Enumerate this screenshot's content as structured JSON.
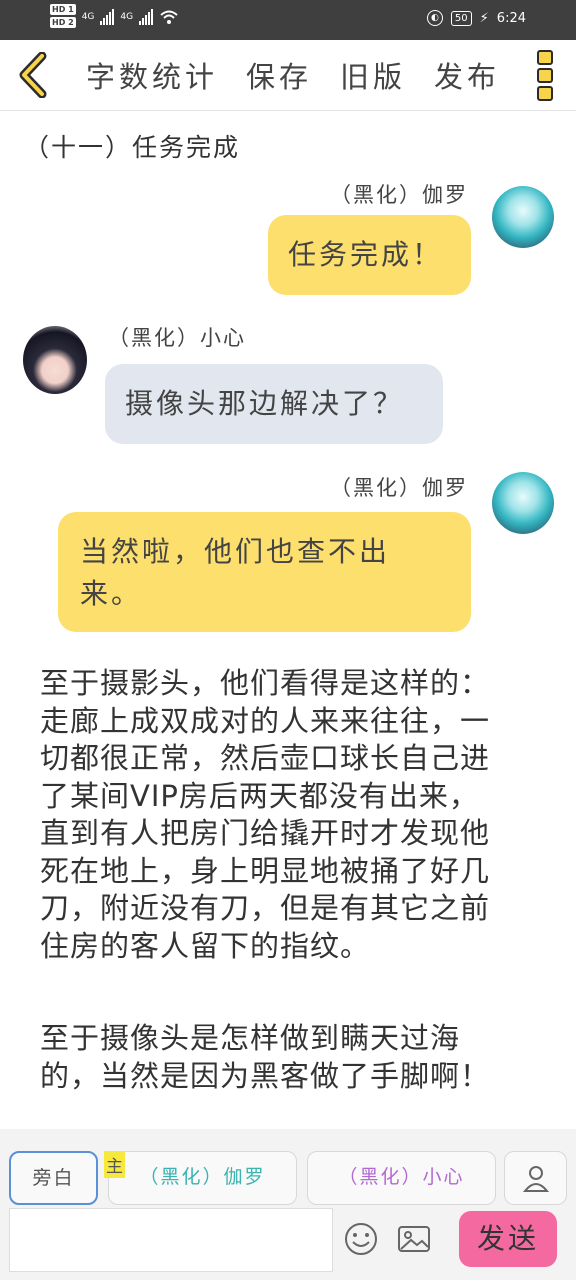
{
  "status_bar": {
    "hd_top": "HD 1",
    "hd_bottom": "HD 2",
    "net1": "4G",
    "net2": "4G",
    "battery": "50",
    "time": "6:24"
  },
  "toolbar": {
    "word_count": "字数统计",
    "save": "保存",
    "old_version": "旧版",
    "publish": "发布"
  },
  "chapter_title": "（十一）任务完成",
  "messages": [
    {
      "speaker": "（黑化）伽罗",
      "text": "任务完成！"
    },
    {
      "speaker": "（黑化）小心",
      "text": "摄像头那边解决了？"
    },
    {
      "speaker": "（黑化）伽罗",
      "text": "当然啦，他们也查不出\n来。"
    }
  ],
  "narration": [
    "至于摄影头，他们看得是这样的：\n走廊上成双成对的人来来往往，一\n切都很正常，然后壶口球长自己进\n了某间VIP房后两天都没有出来，\n直到有人把房门给撬开时才发现他\n死在地上，身上明显地被捅了好几\n刀，附近没有刀，但是有其它之前\n住房的客人留下的指纹。",
    "至于摄像头是怎样做到瞒天过海\n的，当然是因为黑客做了手脚啊！"
  ],
  "composer": {
    "narrator_label": "旁白",
    "main_tag": "主",
    "role1": "（黑化）伽罗",
    "role2": "（黑化）小心",
    "send_label": "发送",
    "input_value": ""
  },
  "colors": {
    "yellow_bubble": "#fddf6e",
    "grey_bubble": "#e2e7ef",
    "send_button": "#f46aa0",
    "role1_text": "#3bb3b0",
    "role2_text": "#b36ad0"
  }
}
